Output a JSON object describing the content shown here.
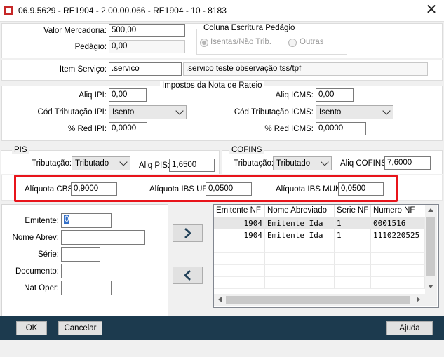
{
  "window": {
    "title": "06.9.5629 - RE1904 - 2.00.00.066 - RE1904 - 10 - 8183",
    "close_glyph": "✕"
  },
  "top": {
    "valor_mercadoria_label": "Valor Mercadoria:",
    "valor_mercadoria_value": "500,00",
    "pedagio_label": "Pedágio:",
    "pedagio_value": "0,00",
    "coluna_title": "Coluna Escritura Pedágio",
    "radio_isentas": "Isentas/Não Trib.",
    "radio_outras": "Outras"
  },
  "item_servico": {
    "label": "Item Serviço:",
    "code": ".servico",
    "description": ".servico teste observação tss/tpf"
  },
  "impostos": {
    "title": "Impostos da Nota de Rateio",
    "aliq_ipi_label": "Aliq IPI:",
    "aliq_ipi_value": "0,00",
    "cod_trib_ipi_label": "Cód Tributação IPI:",
    "cod_trib_ipi_value": "Isento",
    "red_ipi_label": "% Red IPI:",
    "red_ipi_value": "0,0000",
    "aliq_icms_label": "Aliq ICMS:",
    "aliq_icms_value": "0,00",
    "cod_trib_icms_label": "Cód Tributação ICMS:",
    "cod_trib_icms_value": "Isento",
    "red_icms_label": "% Red ICMS:",
    "red_icms_value": "0,0000"
  },
  "pis": {
    "title": "PIS",
    "trib_label": "Tributação:",
    "trib_value": "Tributado",
    "aliq_label": "Aliq PIS:",
    "aliq_value": "1,6500"
  },
  "cofins": {
    "title": "COFINS",
    "trib_label": "Tributação:",
    "trib_value": "Tributado",
    "aliq_label": "Aliq COFINS:",
    "aliq_value": "7,6000"
  },
  "new_taxes": {
    "cbs_label": "Alíquota CBS:",
    "cbs_value": "0,9000",
    "ibs_uf_label": "Alíquota IBS UF:",
    "ibs_uf_value": "0,0500",
    "ibs_mun_label": "Alíquota IBS MUN:",
    "ibs_mun_value": "0,0500",
    "highlight_color": "#e8141b"
  },
  "form": {
    "emitente_label": "Emitente:",
    "emitente_value": "0",
    "nome_abrev_label": "Nome Abrev:",
    "serie_label": "Série:",
    "documento_label": "Documento:",
    "nat_oper_label": "Nat Oper:"
  },
  "grid": {
    "headers": [
      "Emitente NF",
      "Nome Abreviado",
      "Serie NF",
      "Numero NF"
    ],
    "rows": [
      [
        "1904",
        "Emitente Ida",
        "1",
        "0001516"
      ],
      [
        "1904",
        "Emitente Ida",
        "1",
        "1110220525"
      ]
    ]
  },
  "footer": {
    "ok": "OK",
    "cancel": "Cancelar",
    "help": "Ajuda",
    "bar_color": "#1c3a4e"
  }
}
